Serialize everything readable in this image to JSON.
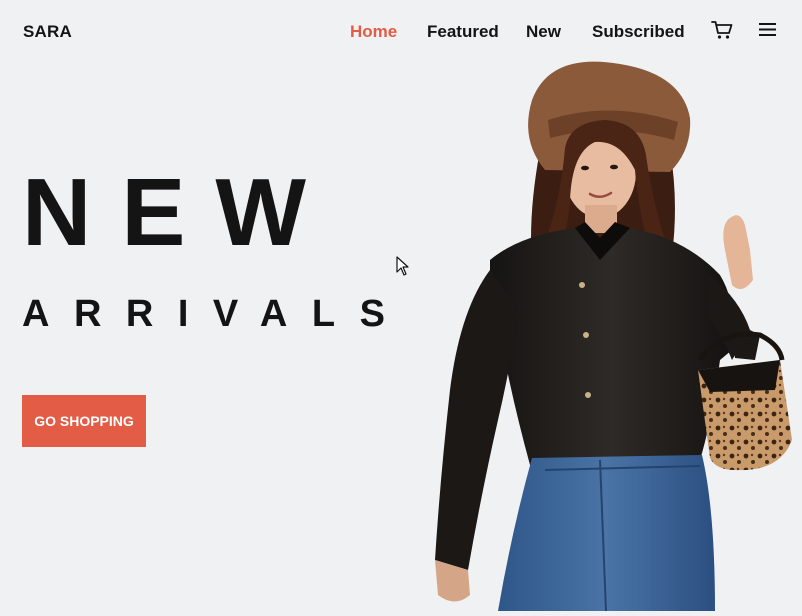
{
  "brand": "SARA",
  "nav": {
    "home": "Home",
    "featured": "Featured",
    "new": "New",
    "subscribed": "Subscribed",
    "cart_icon": "cart-icon",
    "menu_icon": "hamburger-menu-icon"
  },
  "hero": {
    "headline_line1": "NEW",
    "headline_line2": "ARRIVALS",
    "cta_label": "GO SHOPPING",
    "image_alt": "Model wearing brown wide-brim hat, black leather shirt and blue jeans holding a leopard-print handbag"
  },
  "colors": {
    "accent": "#e25c46",
    "background": "#f0f1f3",
    "text": "#141414"
  }
}
